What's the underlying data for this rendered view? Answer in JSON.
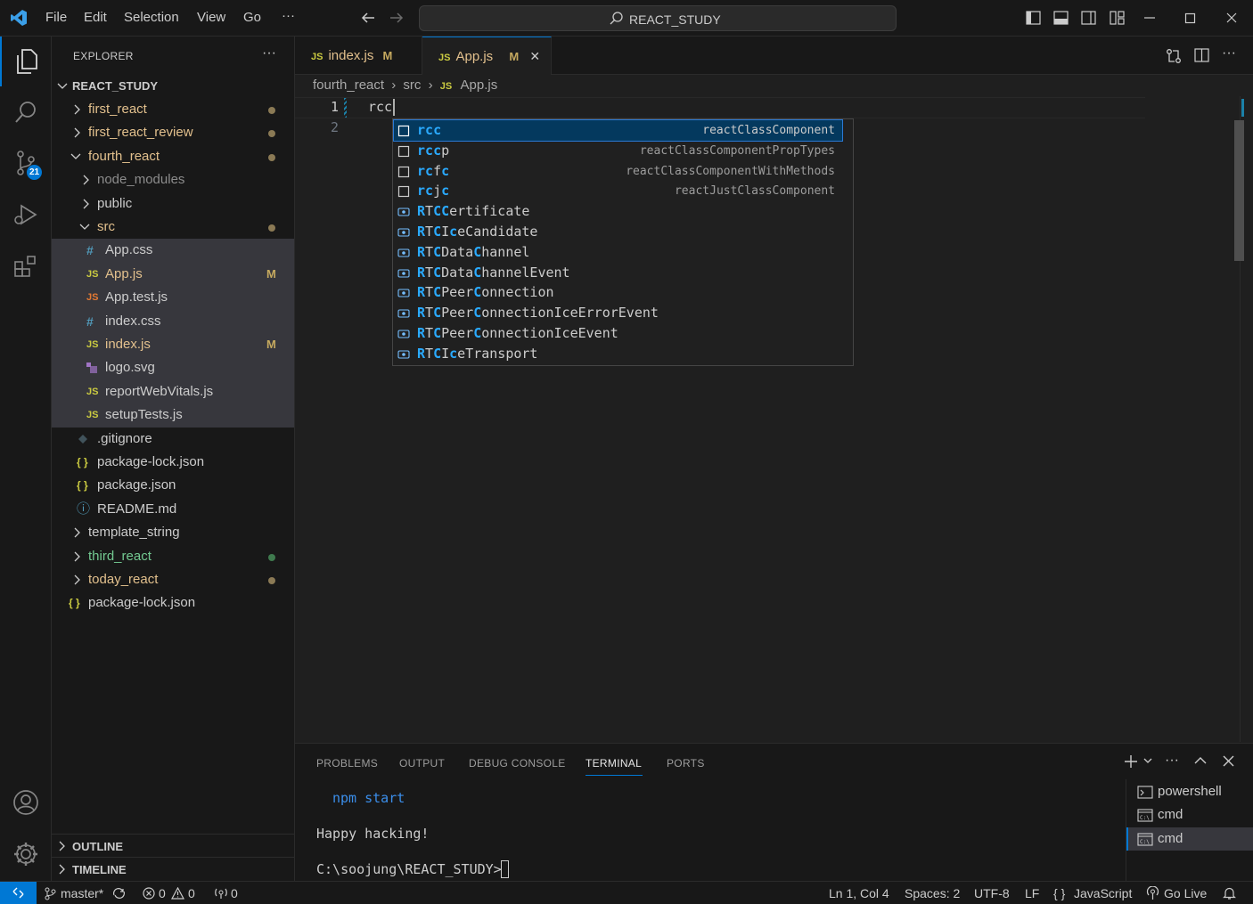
{
  "titlebar": {
    "menus": [
      "File",
      "Edit",
      "Selection",
      "View",
      "Go",
      "···"
    ],
    "search": "REACT_STUDY"
  },
  "activity": {
    "scm_badge": "21"
  },
  "explorer": {
    "header": "EXPLORER",
    "more": "···",
    "root": "REACT_STUDY",
    "items": [
      {
        "label": "first_react"
      },
      {
        "label": "first_react_review"
      },
      {
        "label": "fourth_react"
      },
      {
        "label": "node_modules"
      },
      {
        "label": "public"
      },
      {
        "label": "src"
      },
      {
        "label": "App.css",
        "icon": "#"
      },
      {
        "label": "App.js",
        "icon": "JS",
        "flag": "M"
      },
      {
        "label": "App.test.js",
        "icon": "JS"
      },
      {
        "label": "index.css",
        "icon": "#"
      },
      {
        "label": "index.js",
        "icon": "JS",
        "flag": "M"
      },
      {
        "label": "logo.svg"
      },
      {
        "label": "reportWebVitals.js",
        "icon": "JS"
      },
      {
        "label": "setupTests.js",
        "icon": "JS"
      },
      {
        "label": ".gitignore"
      },
      {
        "label": "package-lock.json",
        "icon": "{ }"
      },
      {
        "label": "package.json",
        "icon": "{ }"
      },
      {
        "label": "README.md",
        "icon": "ⓘ"
      },
      {
        "label": "template_string"
      },
      {
        "label": "third_react"
      },
      {
        "label": "today_react"
      },
      {
        "label": "package-lock.json",
        "icon": "{ }"
      }
    ],
    "outline": "OUTLINE",
    "timeline": "TIMELINE"
  },
  "tabs": [
    {
      "icon": "JS",
      "label": "index.js",
      "flag": "M"
    },
    {
      "icon": "JS",
      "label": "App.js",
      "flag": "M",
      "close": "✕"
    }
  ],
  "breadcrumb": {
    "a": "fourth_react",
    "b": "src",
    "icon": "JS",
    "c": "App.js"
  },
  "editor": {
    "line1": "1",
    "line2": "2",
    "code": "rcc"
  },
  "suggest": [
    {
      "label": "rcc",
      "detail": "reactClassComponent"
    },
    {
      "label": "rccp",
      "detail": "reactClassComponentPropTypes"
    },
    {
      "label": "rcfc",
      "detail": "reactClassComponentWithMethods"
    },
    {
      "label": "rcjc",
      "detail": "reactJustClassComponent"
    },
    {
      "label": "RTCCertificate"
    },
    {
      "label": "RTCIceCandidate"
    },
    {
      "label": "RTCDataChannel"
    },
    {
      "label": "RTCDataChannelEvent"
    },
    {
      "label": "RTCPeerConnection"
    },
    {
      "label": "RTCPeerConnectionIceErrorEvent"
    },
    {
      "label": "RTCPeerConnectionIceEvent"
    },
    {
      "label": "RTCIceTransport"
    }
  ],
  "panel": {
    "tabs": [
      "PROBLEMS",
      "OUTPUT",
      "DEBUG CONSOLE",
      "TERMINAL",
      "PORTS"
    ],
    "term1": "npm start",
    "term2": "Happy hacking!",
    "term3": "C:\\soojung\\REACT_STUDY>",
    "terminals": [
      "powershell",
      "cmd",
      "cmd"
    ]
  },
  "status": {
    "branch": "master*",
    "errors": "0",
    "warnings": "0",
    "ports": "0",
    "position": "Ln 1, Col 4",
    "spaces": "Spaces: 2",
    "encoding": "UTF-8",
    "eol": "LF",
    "language": "JavaScript",
    "golive": "Go Live"
  },
  "colors": {
    "accent": "#0078d4",
    "modified": "#e2c08d",
    "untracked": "#73c991",
    "match": "#2aaaff"
  }
}
